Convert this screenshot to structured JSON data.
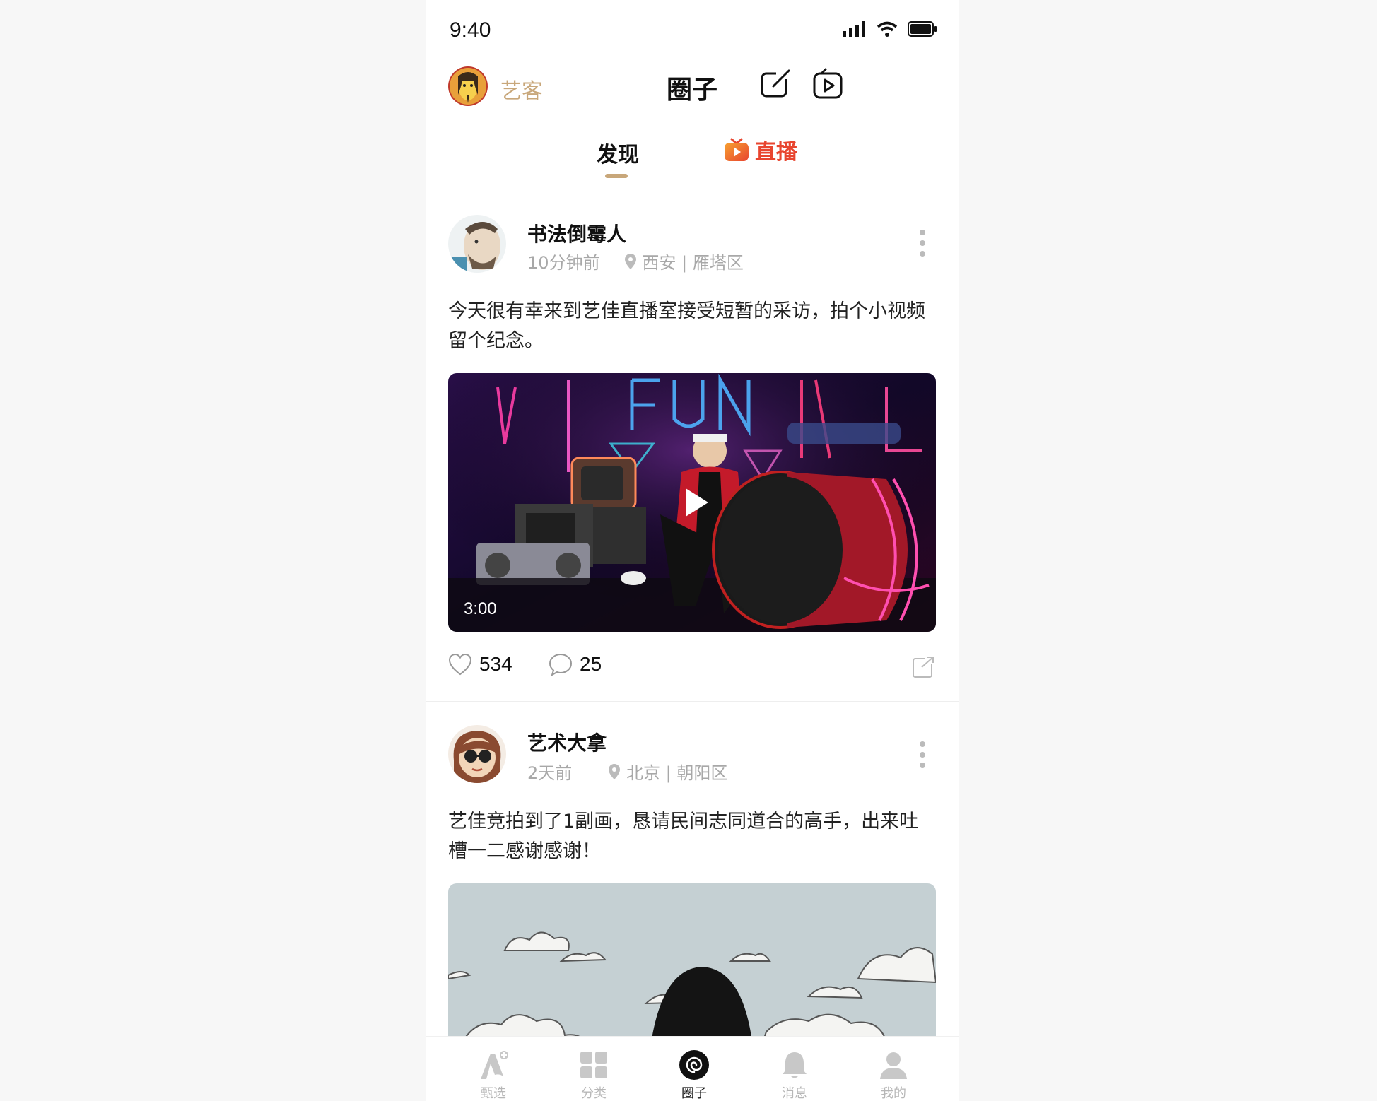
{
  "status_bar": {
    "time": "9:40"
  },
  "header": {
    "brand": "艺客",
    "title": "圈子",
    "compose_icon": "compose-icon",
    "video_icon": "video-upload-icon"
  },
  "tabs": {
    "discover": "发现",
    "live": "直播"
  },
  "posts": [
    {
      "author": "书法倒霉人",
      "time_ago": "10分钟前",
      "location": "西安 | 雁塔区",
      "text": "今天很有幸来到艺佳直播室接受短暂的采访，拍个小视频留个纪念。",
      "video_duration": "3:00",
      "likes": "534",
      "comments": "25"
    },
    {
      "author": "艺术大拿",
      "time_ago": "2天前",
      "location": "北京 | 朝阳区",
      "text": "艺佳竞拍到了1副画，恳请民间志同道合的高手，出来吐槽一二感谢感谢！"
    }
  ],
  "tabbar": {
    "items": [
      {
        "label": "甄选",
        "icon": "featured-icon"
      },
      {
        "label": "分类",
        "icon": "category-grid-icon"
      },
      {
        "label": "圈子",
        "icon": "circle-spiral-icon"
      },
      {
        "label": "消息",
        "icon": "bell-icon"
      },
      {
        "label": "我的",
        "icon": "profile-icon"
      }
    ],
    "active": "圈子"
  },
  "colors": {
    "accent_gold": "#c8a77a",
    "live_red": "#e8452f",
    "inactive_gray": "#b7b7b7"
  }
}
